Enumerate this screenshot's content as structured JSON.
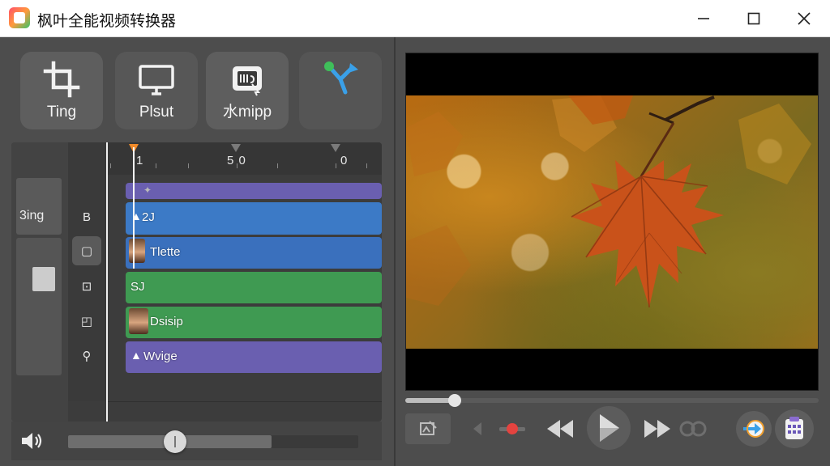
{
  "window": {
    "title": "枫叶全能视频转换器"
  },
  "toolbar": {
    "crop_label": "Ting",
    "display_label": "Plsut",
    "watermark_label": "水mipp",
    "merge_label": ""
  },
  "timeline": {
    "ruler_labels": [
      "1",
      "5 0",
      "0"
    ],
    "left_thumb_label": "3ing",
    "side_icons": [
      "B",
      "▢",
      "⊡",
      "◰",
      "⚲"
    ],
    "clips": [
      {
        "label": "",
        "glyph": "✦",
        "color": "#6a5fb0"
      },
      {
        "label": "2J",
        "glyph": "▲",
        "color": "#3c7ac6"
      },
      {
        "label": "Tlette",
        "glyph": "",
        "color": "#3a70bd",
        "avatar": true
      },
      {
        "label": "SJ",
        "glyph": "",
        "color": "#3f9a52"
      },
      {
        "label": "Dsisip",
        "glyph": "",
        "color": "#3f9a52",
        "avatar": true
      },
      {
        "label": "Wvige",
        "glyph": "▲",
        "color": "#6a5fb0"
      }
    ],
    "volume_level": 0.37
  },
  "player": {
    "seek_position": 0.12
  },
  "colors": {
    "accent_orange": "#f28b2a",
    "accent_blue": "#3aa0e8",
    "merge_green": "#3fbf5a"
  },
  "icons": {
    "app": "app-logo-icon",
    "minimize": "minimize-icon",
    "maximize": "maximize-icon",
    "close": "close-icon",
    "crop": "crop-icon",
    "display": "monitor-icon",
    "watermark": "watermark-icon",
    "merge": "merge-icon",
    "volume": "speaker-icon",
    "play": "play-icon"
  }
}
